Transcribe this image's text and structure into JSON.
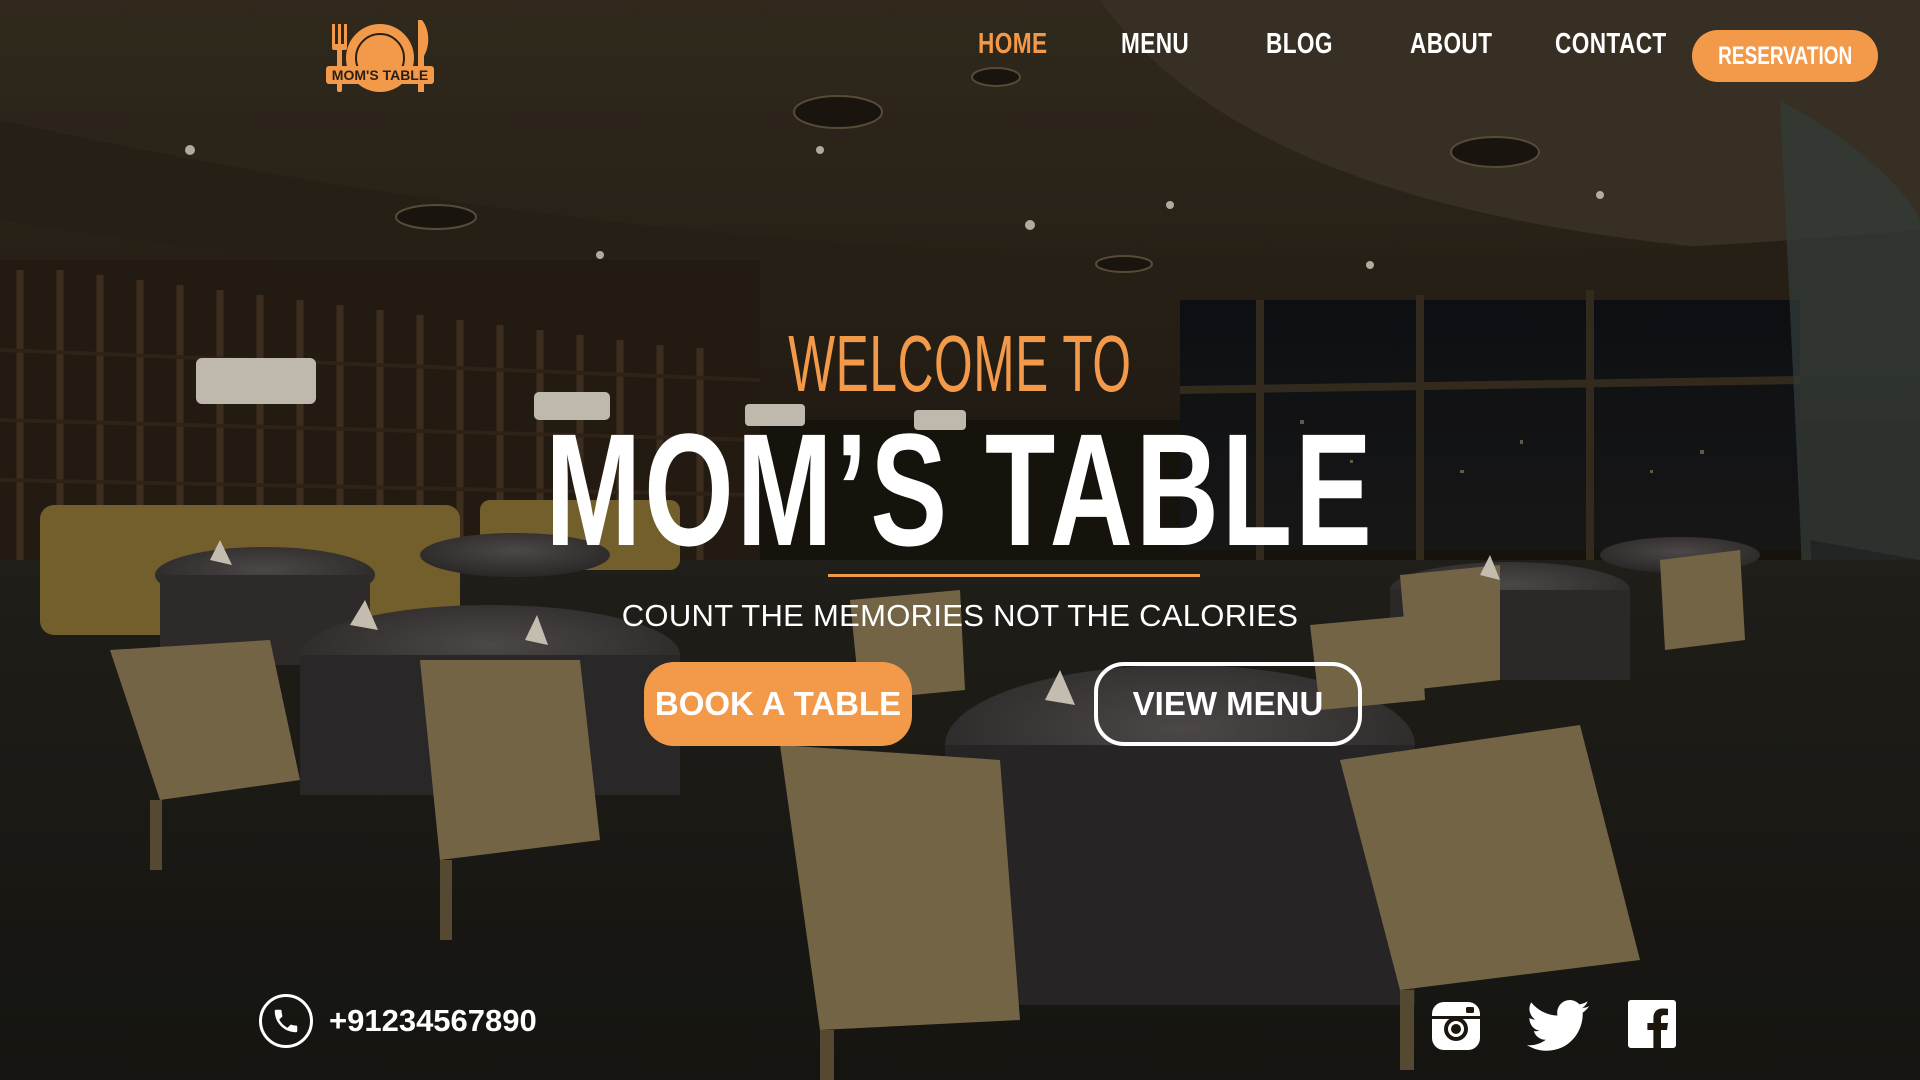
{
  "brand": {
    "logo_text": "MOM'S TABLE",
    "accent_color": "#f39a4a",
    "text_color": "#ffffff"
  },
  "nav": {
    "items": [
      {
        "label": "HOME",
        "active": true
      },
      {
        "label": "MENU",
        "active": false
      },
      {
        "label": "BLOG",
        "active": false
      },
      {
        "label": "ABOUT",
        "active": false
      },
      {
        "label": "CONTACT",
        "active": false
      }
    ],
    "reservation_label": "RESERVATION"
  },
  "hero": {
    "welcome": "WELCOME TO",
    "title": "MOM’S TABLE",
    "tagline": "COUNT THE MEMORIES NOT THE CALORIES",
    "book_label": "BOOK A TABLE",
    "menu_label": "VIEW MENU"
  },
  "footer": {
    "phone": "+91234567890",
    "phone_icon": "phone-icon",
    "social": [
      "instagram-icon",
      "twitter-icon",
      "facebook-icon"
    ]
  }
}
